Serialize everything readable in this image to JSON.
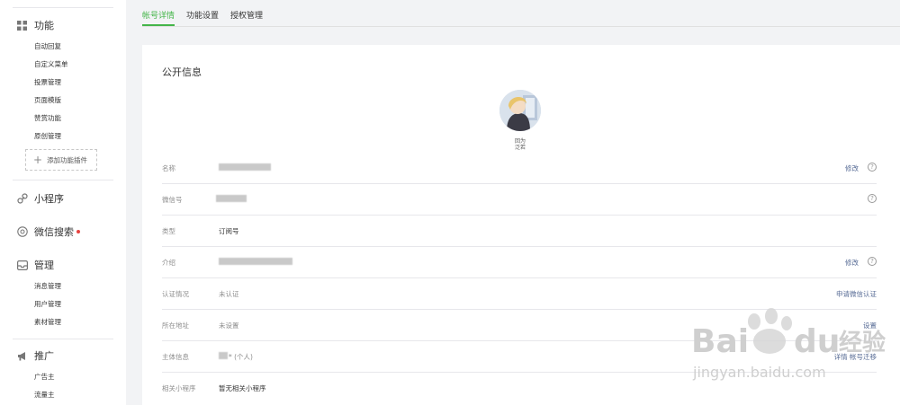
{
  "tabs": [
    {
      "label": "帐号详情"
    },
    {
      "label": "功能设置"
    },
    {
      "label": "授权管理"
    }
  ],
  "sidebar": {
    "features": {
      "title": "功能",
      "icon": "grid-icon",
      "items": [
        "自动回复",
        "自定义菜单",
        "投票管理",
        "页面模版",
        "赞赏功能",
        "原创管理"
      ],
      "add_plugin": "添加功能插件"
    },
    "miniprogram": {
      "title": "小程序",
      "icon": "link-icon"
    },
    "search": {
      "title": "微信搜索",
      "icon": "search-circle-icon"
    },
    "manage": {
      "title": "管理",
      "icon": "inbox-icon",
      "items": [
        "消息管理",
        "用户管理",
        "素材管理"
      ]
    },
    "promote": {
      "title": "推广",
      "icon": "megaphone-icon",
      "items": [
        "广告主",
        "流量主"
      ]
    }
  },
  "panel": {
    "title": "公开信息",
    "qr_text_line1": "回为",
    "qr_text_line2": "泛若",
    "rows": [
      {
        "label": "名称",
        "value": "",
        "action": "修改",
        "help": "?"
      },
      {
        "label": "微信号",
        "value": "",
        "action": "",
        "help": "?"
      },
      {
        "label": "类型",
        "value": "订阅号",
        "action": "",
        "help": ""
      },
      {
        "label": "介绍",
        "value": "",
        "action": "修改",
        "help": "?"
      },
      {
        "label": "认证情况",
        "value": "未认证",
        "action": "申请微信认证",
        "help": ""
      },
      {
        "label": "所在地址",
        "value": "未设置",
        "action": "设置",
        "help": ""
      },
      {
        "label": "主体信息",
        "value": "* (个人)",
        "action": "详情 帐号迁移",
        "help": ""
      },
      {
        "label": "相关小程序",
        "value": "暂无相关小程序",
        "action": "",
        "help": ""
      }
    ]
  },
  "watermark": {
    "brand": "Bai",
    "brand2": "du",
    "cn": "经验",
    "url": "jingyan.baidu.com"
  }
}
